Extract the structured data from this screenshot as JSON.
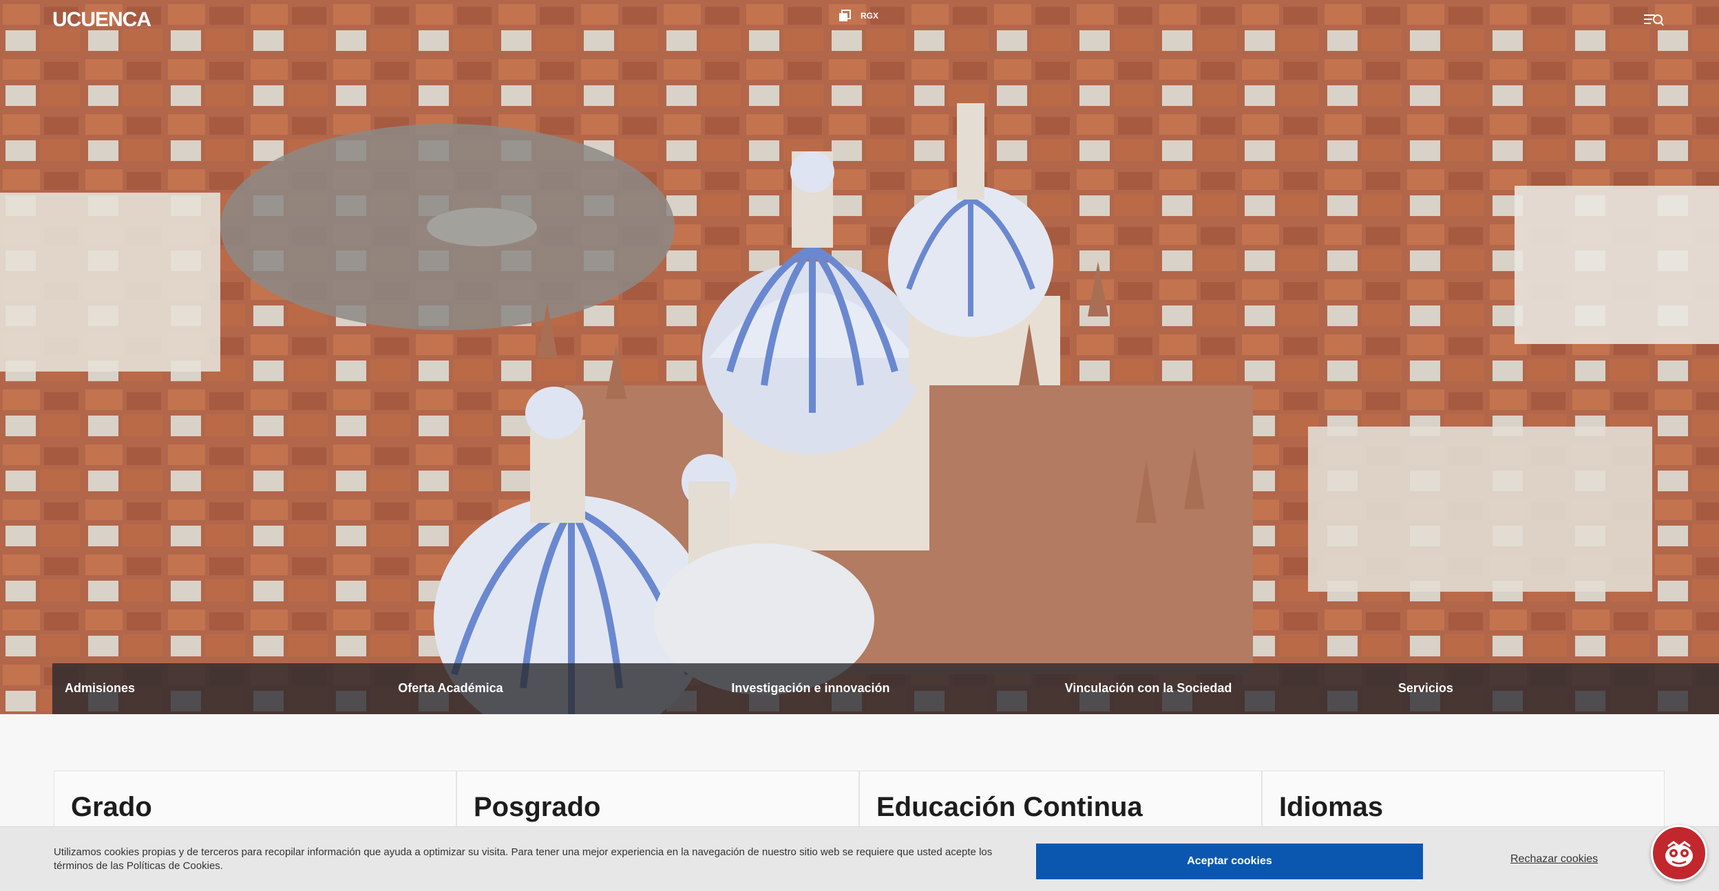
{
  "header": {
    "logo_text": "UCUENCA",
    "rgx_label": "RGX",
    "icons": [
      "copy-window-icon",
      "menu-search-icon"
    ]
  },
  "nav": {
    "items": [
      {
        "label": "Admisiones"
      },
      {
        "label": "Oferta Académica"
      },
      {
        "label": "Investigación e innovación"
      },
      {
        "label": "Vinculación con la Sociedad"
      },
      {
        "label": "Servicios"
      }
    ]
  },
  "cards": [
    {
      "title": "Grado"
    },
    {
      "title": "Posgrado"
    },
    {
      "title": "Educación Continua"
    },
    {
      "title": "Idiomas"
    }
  ],
  "cookie": {
    "text": "Utilizamos cookies propias y de terceros para recopilar información que ayuda a optimizar su visita. Para tener una mejor experiencia en la navegación de nuestro sitio web se requiere que usted acepte los términos de las Políticas de Cookies.",
    "accept_label": "Aceptar cookies",
    "reject_label": "Rechazar cookies"
  },
  "colors": {
    "accent": "#0b57b0",
    "chat": "#c1272d",
    "nav_bg": "#28282d"
  }
}
